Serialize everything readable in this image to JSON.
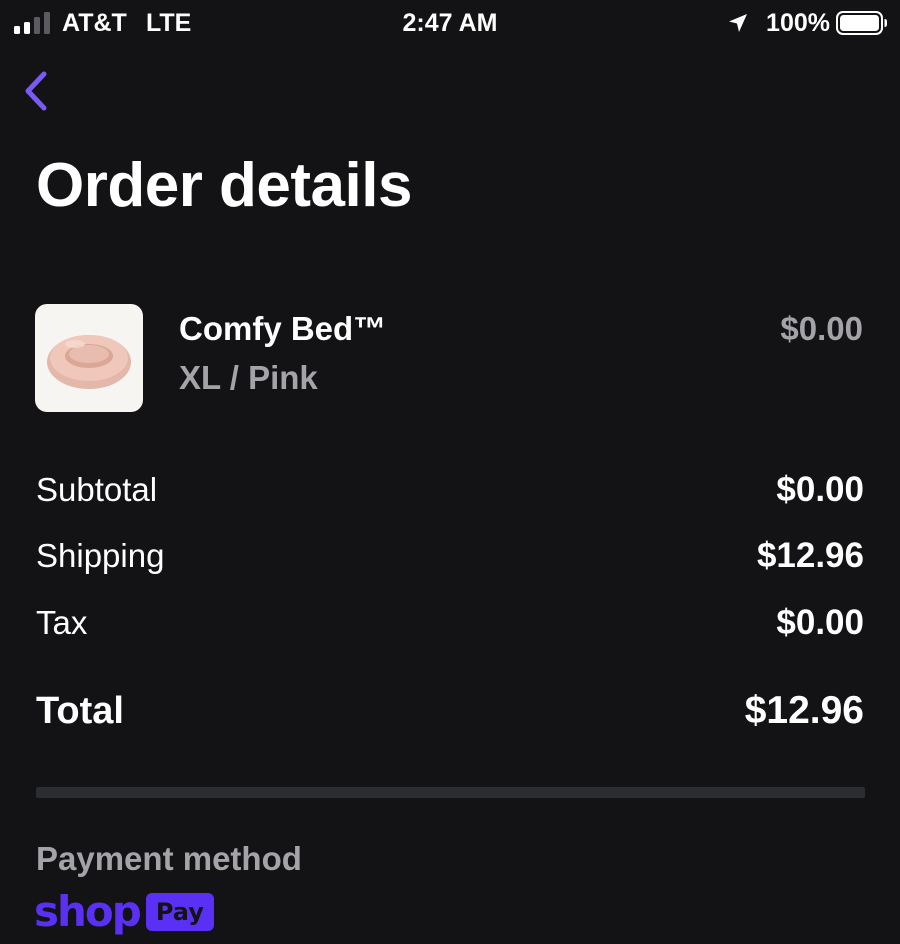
{
  "status_bar": {
    "carrier": "AT&T",
    "network": "LTE",
    "time": "2:47 AM",
    "battery_percent": "100%",
    "signal_bars_filled": 2,
    "signal_bars_total": 4,
    "battery_level": 1.0
  },
  "header": {
    "back_icon": "chevron-left-icon",
    "title": "Order details"
  },
  "line_item": {
    "name": "Comfy Bed™",
    "variant": "XL / Pink",
    "price": "$0.00",
    "image_icon": "pink-round-pet-bed-image"
  },
  "summary": {
    "subtotal_label": "Subtotal",
    "subtotal_value": "$0.00",
    "shipping_label": "Shipping",
    "shipping_value": "$12.96",
    "tax_label": "Tax",
    "tax_value": "$0.00",
    "total_label": "Total",
    "total_value": "$12.96"
  },
  "payment": {
    "label": "Payment method",
    "brand_word": "shop",
    "brand_badge": "Pay"
  },
  "colors": {
    "background": "#131315",
    "accent": "#5a31f4",
    "back_chevron": "#7a5af5",
    "muted_text": "#a3a3a8",
    "divider": "#2b2d30"
  }
}
